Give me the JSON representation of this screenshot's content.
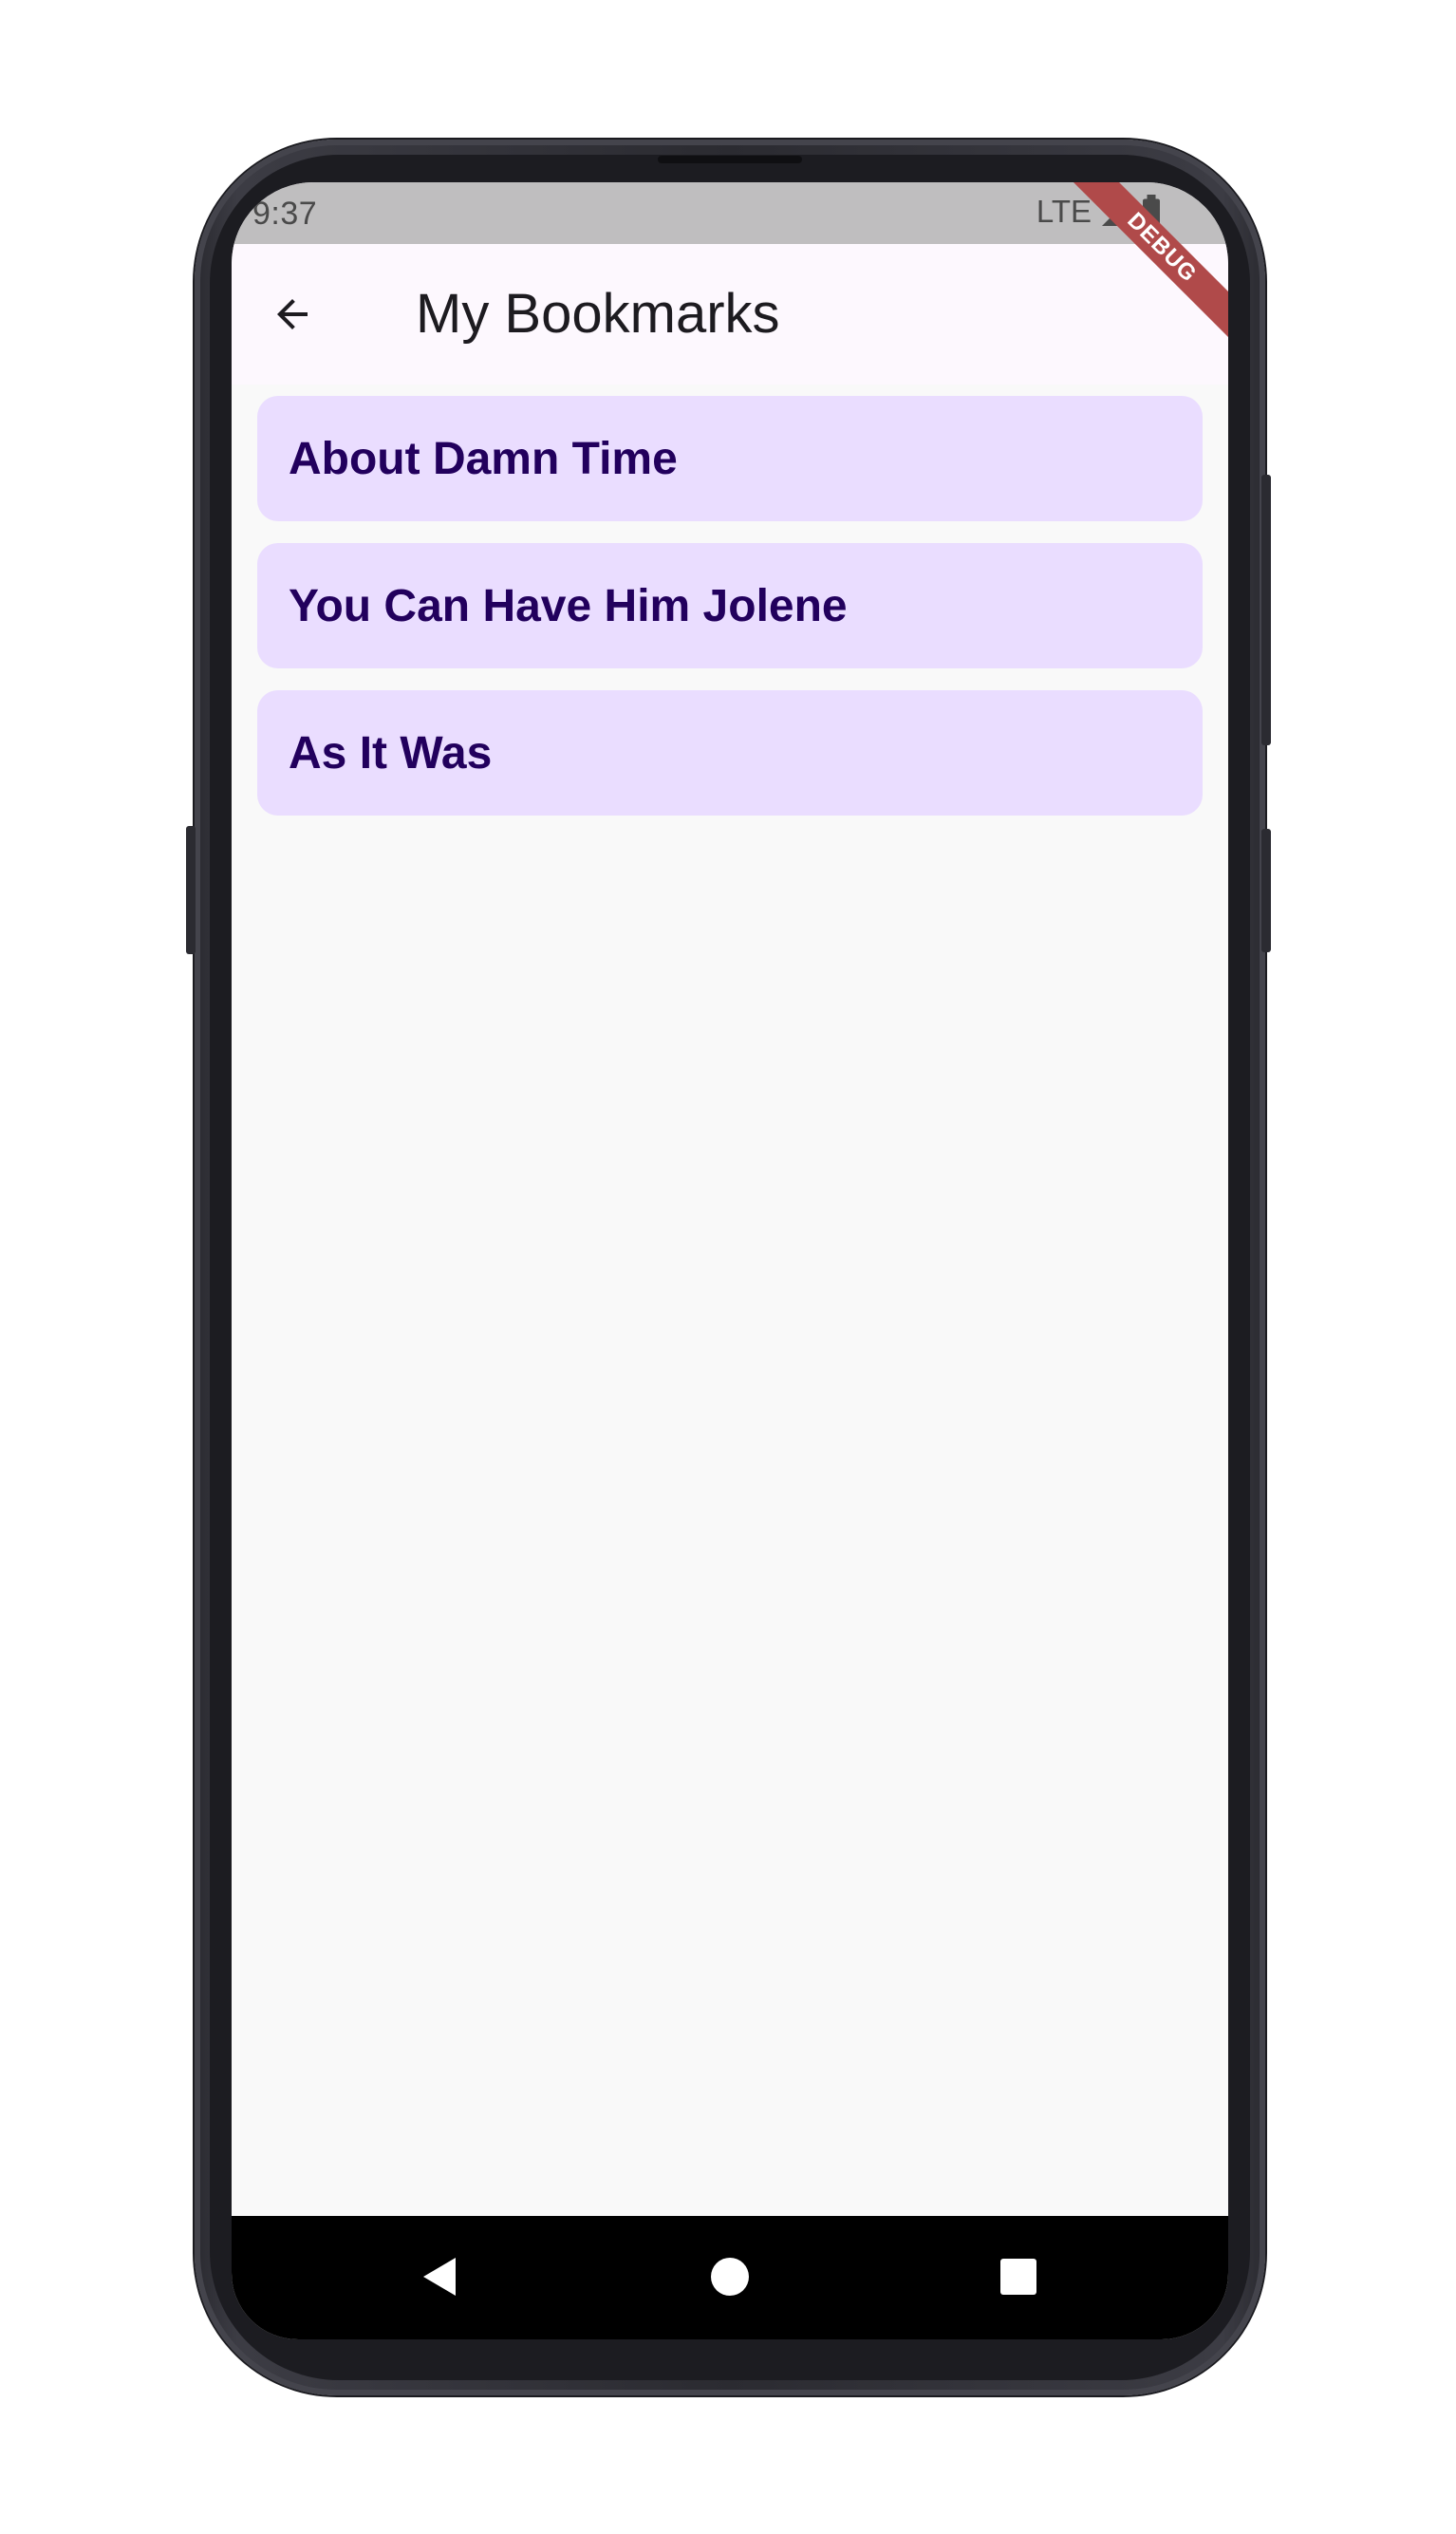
{
  "status_bar": {
    "time": "9:37",
    "network": "LTE",
    "signal_icon": "signal-icon",
    "battery_icon": "battery-icon"
  },
  "debug_banner": "DEBUG",
  "app_bar": {
    "back_icon": "arrow-back-icon",
    "title": "My Bookmarks"
  },
  "bookmarks": [
    {
      "label": "About Damn Time"
    },
    {
      "label": "You Can Have Him Jolene"
    },
    {
      "label": "As It Was"
    }
  ],
  "nav_bar": {
    "back_icon": "triangle-back-icon",
    "home_icon": "circle-home-icon",
    "recents_icon": "square-recents-icon"
  },
  "colors": {
    "app_bar_bg": "#fdf8fe",
    "list_item_bg": "#eaddff",
    "list_item_text": "#22005d",
    "screen_bg": "#f9f9f9",
    "status_bar_bg": "#bfbebf",
    "debug_ribbon": "#b04a4a"
  }
}
